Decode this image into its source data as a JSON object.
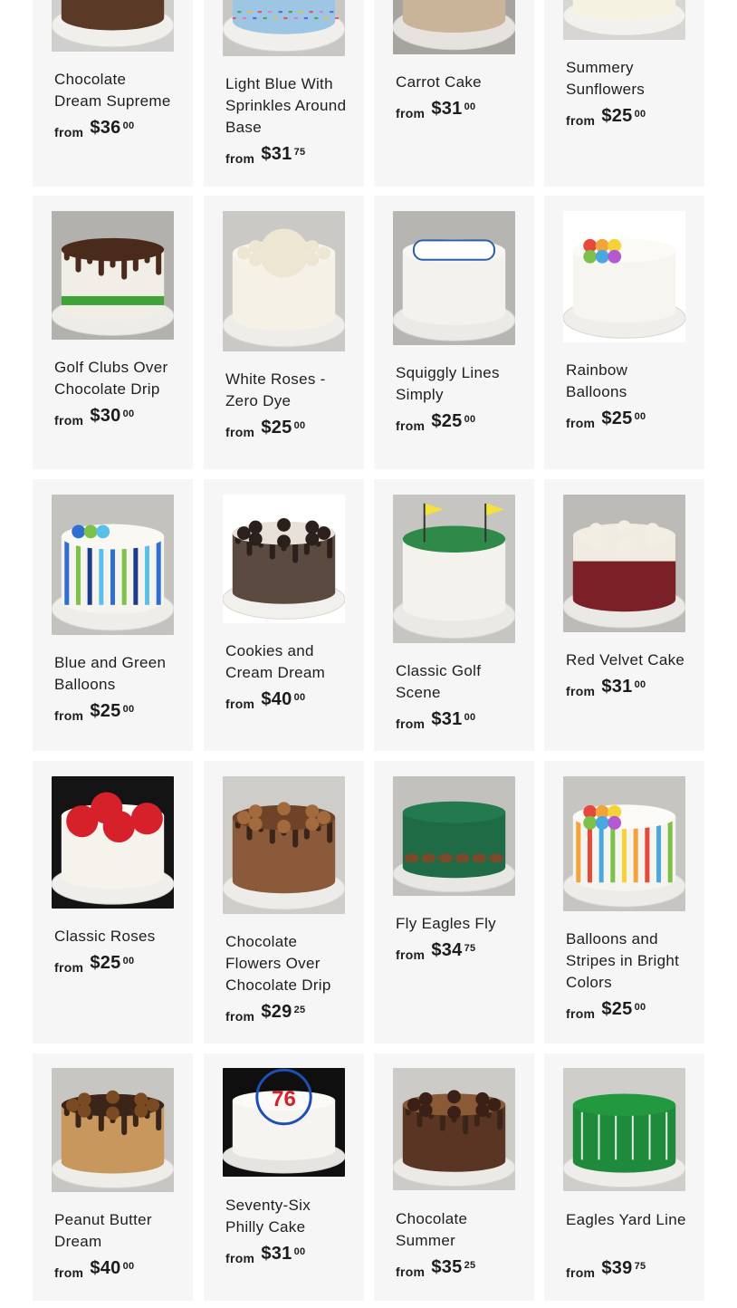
{
  "products": [
    {
      "title": "Chocolate Dream Supreme",
      "from": "from",
      "dollars": "$36",
      "cents": "00",
      "scene": "choc-swirl",
      "bg": "#d0cfce",
      "board": "#f1efeb",
      "base": "#5a3a26",
      "top": "#6b4530",
      "deco": "#4a2b1a"
    },
    {
      "title": "Light Blue With Sprinkles Around Base",
      "from": "from",
      "dollars": "$31",
      "cents": "75",
      "scene": "sprinkle",
      "bg": "#c9c7c4",
      "board": "#f1efeb",
      "base": "#9cc6e4",
      "top": "#b4d7ef",
      "deco": "#e05a5a"
    },
    {
      "title": "Carrot Cake",
      "from": "from",
      "dollars": "$31",
      "cents": "00",
      "scene": "speckle",
      "bg": "#a7a39f",
      "board": "#e6e3de",
      "base": "#c9b49a",
      "top": "#d7c8b4",
      "deco": "#7a6448"
    },
    {
      "title": "Summery Sunflowers",
      "from": "from",
      "dollars": "$25",
      "cents": "00",
      "scene": "sunflower",
      "bg": "#d8d6d3",
      "board": "#f3f1ed",
      "base": "#f6f2e2",
      "top": "#fbf8ee",
      "deco": "#f2c230"
    },
    {
      "title": "Golf Clubs Over Chocolate Drip",
      "from": "from",
      "dollars": "$30",
      "cents": "00",
      "scene": "golf-drip",
      "bg": "#b3b1ae",
      "board": "#eeece8",
      "base": "#f1eee7",
      "top": "#4a2a1a",
      "deco": "#3fa33a"
    },
    {
      "title": "White Roses - Zero Dye",
      "from": "from",
      "dollars": "$25",
      "cents": "00",
      "scene": "white-roses",
      "bg": "#cbc9c6",
      "board": "#efede9",
      "base": "#f5f1e6",
      "top": "#f8f5ec",
      "deco": "#ede6d2"
    },
    {
      "title": "Squiggly Lines Simply",
      "from": "from",
      "dollars": "$25",
      "cents": "00",
      "scene": "squiggle",
      "bg": "#b7b5b2",
      "board": "#eceae6",
      "base": "#f4f2ee",
      "top": "#f8f6f2",
      "deco": "#2b5fa8"
    },
    {
      "title": "Rainbow Balloons",
      "from": "from",
      "dollars": "$25",
      "cents": "00",
      "scene": "balloons",
      "bg": "#ffffff",
      "board": "#f0eeea",
      "base": "#f7f5f0",
      "top": "#fbfaf6",
      "deco": "#e8473c"
    },
    {
      "title": "Blue and Green Balloons",
      "from": "from",
      "dollars": "$25",
      "cents": "00",
      "scene": "stripes-bg",
      "bg": "#c4c2bf",
      "board": "#efede9",
      "base": "#f6f4ef",
      "top": "#faf8f3",
      "deco": "#2f6fd1"
    },
    {
      "title": "Cookies and Cream Dream",
      "from": "from",
      "dollars": "$40",
      "cents": "00",
      "scene": "oreo",
      "bg": "#ffffff",
      "board": "#f2f0ec",
      "base": "#5b4a40",
      "top": "#e7e1d9",
      "deco": "#2b201b"
    },
    {
      "title": "Classic Golf Scene",
      "from": "from",
      "dollars": "$31",
      "cents": "00",
      "scene": "golf-scene",
      "bg": "#c7c5c2",
      "board": "#ebe9e5",
      "base": "#f4f2ed",
      "top": "#2f8a4a",
      "deco": "#f4e23a"
    },
    {
      "title": "Red Velvet Cake",
      "from": "from",
      "dollars": "$31",
      "cents": "00",
      "scene": "red-velvet",
      "bg": "#bdbbb8",
      "board": "#ebe9e5",
      "base": "#7a2026",
      "top": "#f1ece2",
      "deco": "#f3eee4"
    },
    {
      "title": "Classic Roses",
      "from": "from",
      "dollars": "$25",
      "cents": "00",
      "scene": "roses",
      "bg": "#141414",
      "board": "#f0eeea",
      "base": "#f6f3ec",
      "top": "#fbf9f3",
      "deco": "#d6202a"
    },
    {
      "title": "Chocolate Flowers Over Chocolate Drip",
      "from": "from",
      "dollars": "$29",
      "cents": "25",
      "scene": "choc-flowers",
      "bg": "#cfcdca",
      "board": "#eeece8",
      "base": "#8a5a3a",
      "top": "#6e4327",
      "deco": "#a36a3e"
    },
    {
      "title": "Fly Eagles Fly",
      "from": "from",
      "dollars": "$34",
      "cents": "75",
      "scene": "eagles",
      "bg": "#c3c1be",
      "board": "#e9e7e3",
      "base": "#1f6b45",
      "top": "#237a4f",
      "deco": "#7a4a2a"
    },
    {
      "title": "Balloons and Stripes in Bright Colors",
      "from": "from",
      "dollars": "$25",
      "cents": "00",
      "scene": "bright-stripes",
      "bg": "#c7c5c2",
      "board": "#eeece8",
      "base": "#f6f4ef",
      "top": "#fbfaf6",
      "deco": "#f2a33a"
    },
    {
      "title": "Peanut Butter Dream",
      "from": "from",
      "dollars": "$40",
      "cents": "00",
      "scene": "pb-drip",
      "bg": "#c8c6c3",
      "board": "#efede9",
      "base": "#c7975e",
      "top": "#3b2418",
      "deco": "#7a4a22"
    },
    {
      "title": "Seventy-Six Philly Cake",
      "from": "from",
      "dollars": "$31",
      "cents": "00",
      "scene": "76ers",
      "bg": "#0f0f0f",
      "board": "#e6e4e0",
      "base": "#f6f4f0",
      "top": "#fbfaf7",
      "deco": "#1d4fb5"
    },
    {
      "title": "Chocolate Summer",
      "from": "from",
      "dollars": "$35",
      "cents": "25",
      "scene": "choc-summer",
      "bg": "#cdcbc8",
      "board": "#eceae6",
      "base": "#5b3524",
      "top": "#8a5a36",
      "deco": "#3a2016"
    },
    {
      "title": "Eagles Yard Line",
      "from": "from",
      "dollars": "$39",
      "cents": "75",
      "scene": "yard-line",
      "bg": "#d0cecb",
      "board": "#efede9",
      "base": "#1f8a3c",
      "top": "#23993f",
      "deco": "#ffffff"
    }
  ]
}
